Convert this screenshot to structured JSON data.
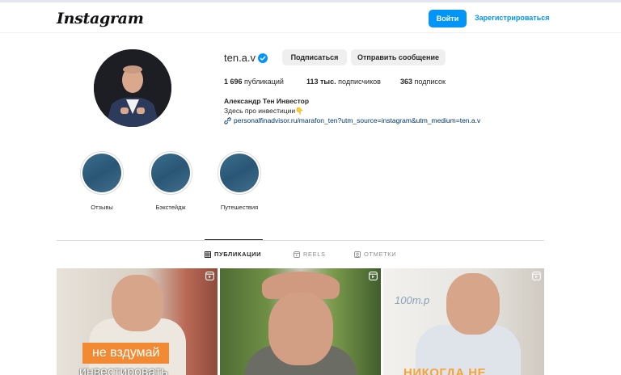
{
  "header": {
    "logo": "Instagram",
    "login_label": "Войти",
    "register_label": "Зарегистрироваться"
  },
  "profile": {
    "username": "ten.a.v",
    "follow_label": "Подписаться",
    "message_label": "Отправить сообщение",
    "stats": {
      "posts_count": "1 696",
      "posts_label": "публикаций",
      "followers_count": "113 тыс.",
      "followers_label": "подписчиков",
      "following_count": "363",
      "following_label": "подписок"
    },
    "full_name": "Александр Тен Инвестор",
    "bio": "Здесь про инвестиции👇",
    "link": "personalfinadvisor.ru/marafon_ten?utm_source=instagram&utm_medium=ten.a.v"
  },
  "highlights": [
    {
      "label": "Отзывы"
    },
    {
      "label": "Бэкстейдж"
    },
    {
      "label": "Путешествия"
    }
  ],
  "tabs": {
    "posts": "ПУБЛИКАЦИИ",
    "reels": "REELS",
    "tagged": "ОТМЕТКИ"
  },
  "posts": [
    {
      "caption_line1": "не вздумай",
      "caption_line2": "инвестировать"
    },
    {},
    {
      "board_text": "100т.р",
      "caption": "НИКОГДА НЕ"
    }
  ],
  "colors": {
    "accent": "#0095f6",
    "verified": "#0095f6",
    "link": "#00376b",
    "caption_bg": "#f28a33"
  }
}
